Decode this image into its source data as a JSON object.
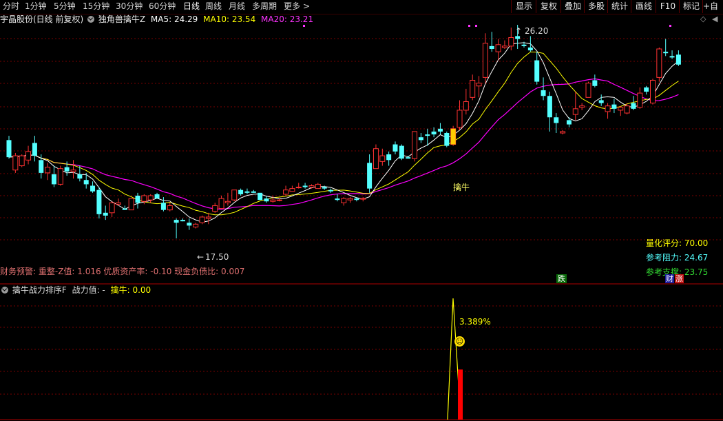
{
  "toolbar": {
    "periods": [
      "分时",
      "1分钟",
      "5分钟",
      "15分钟",
      "30分钟",
      "60分钟",
      "日线",
      "周线",
      "月线",
      "多周期",
      "更多"
    ],
    "active_index": 6,
    "more_arrow": ">",
    "right_buttons": [
      "显示",
      "复权",
      "叠加",
      "多股",
      "统计",
      "画线",
      "F10",
      "标记",
      "+自选"
    ],
    "small_icons": [
      "◇",
      "◀"
    ]
  },
  "info": {
    "stock": "宇晶股份(日线 前复权)",
    "indicator": "独角兽擒牛Z",
    "ma5_label": "MA5: 24.29",
    "ma10_label": "MA10: 23.54",
    "ma20_label": "MA20: 23.21"
  },
  "annotations": {
    "high_label": "26.20",
    "low_label": "17.50",
    "buy_label": "擒牛",
    "fall_badge": "跌",
    "rise_badge": "涨",
    "finance_badge": "财"
  },
  "metrics": {
    "score_label": "量化评分:",
    "score_value": "70.00",
    "resist_label": "参考阻力:",
    "resist_value": "24.67",
    "support_label": "参考支撑:",
    "support_value": "23.75"
  },
  "footer_text": "财务预警: 重整-Z值: 1.016 优质资产率: -0.10 现金负债比: 0.007",
  "sub": {
    "title": "擒牛战力排序F",
    "power_label": "战力值: -",
    "bull_label": "擒牛: 0.00",
    "peak_label": "3.389%"
  },
  "colors": {
    "up": "#ff3232",
    "down": "#54ffff",
    "ma5": "#ffffff",
    "ma10": "#ffff00",
    "ma20": "#ff00ff",
    "grid": "#7a0000"
  },
  "candles": [
    [
      24.4,
      24.7,
      23.1,
      23.2
    ],
    [
      22.3,
      23.5,
      22.1,
      23.3
    ],
    [
      22.6,
      23.4,
      22.5,
      23.3
    ],
    [
      23.0,
      24.0,
      22.7,
      23.6
    ],
    [
      24.2,
      24.7,
      22.9,
      23.3
    ],
    [
      23.0,
      23.4,
      21.7,
      22.1
    ],
    [
      22.1,
      22.8,
      21.6,
      22.5
    ],
    [
      22.0,
      22.6,
      21.1,
      21.3
    ],
    [
      21.3,
      22.6,
      21.2,
      22.4
    ],
    [
      22.5,
      22.9,
      21.9,
      22.2
    ],
    [
      22.2,
      23.0,
      21.7,
      22.3
    ],
    [
      22.0,
      22.6,
      21.5,
      21.7
    ],
    [
      21.6,
      22.1,
      21.0,
      21.3
    ],
    [
      21.2,
      21.5,
      20.7,
      20.8
    ],
    [
      20.9,
      21.1,
      18.9,
      19.2
    ],
    [
      19.3,
      19.8,
      18.8,
      19.1
    ],
    [
      19.3,
      20.1,
      19.0,
      20.0
    ],
    [
      19.9,
      20.3,
      19.8,
      20.0
    ],
    [
      19.6,
      19.8,
      19.5,
      19.5
    ],
    [
      19.5,
      20.3,
      19.5,
      20.3
    ],
    [
      20.5,
      20.7,
      19.6,
      20.0
    ],
    [
      20.1,
      20.6,
      19.9,
      20.5
    ],
    [
      20.2,
      20.6,
      20.0,
      20.5
    ],
    [
      20.6,
      20.7,
      20.3,
      20.3
    ],
    [
      20.0,
      20.4,
      19.4,
      19.5
    ],
    [
      19.5,
      20.0,
      19.4,
      19.8
    ],
    [
      18.8,
      18.9,
      17.5,
      18.6
    ],
    [
      18.8,
      18.9,
      18.7,
      18.7
    ],
    [
      18.6,
      18.9,
      18.1,
      18.4
    ],
    [
      18.3,
      18.6,
      18.2,
      18.5
    ],
    [
      18.6,
      19.1,
      18.5,
      19.0
    ],
    [
      18.9,
      19.3,
      18.5,
      19.0
    ],
    [
      19.4,
      20.0,
      19.3,
      19.8
    ],
    [
      19.6,
      20.5,
      19.6,
      20.3
    ],
    [
      20.0,
      20.7,
      19.8,
      20.1
    ],
    [
      20.2,
      20.9,
      20.1,
      20.9
    ],
    [
      20.9,
      21.0,
      20.5,
      20.6
    ],
    [
      20.8,
      21.0,
      20.6,
      20.7
    ],
    [
      20.8,
      20.9,
      20.7,
      20.7
    ],
    [
      20.7,
      20.7,
      20.2,
      20.2
    ],
    [
      20.3,
      20.5,
      20.0,
      20.1
    ],
    [
      20.1,
      20.5,
      20.0,
      20.2
    ],
    [
      20.2,
      20.3,
      20.1,
      20.2
    ],
    [
      20.6,
      21.2,
      20.5,
      20.9
    ],
    [
      20.8,
      21.2,
      20.8,
      21.0
    ],
    [
      21.1,
      21.4,
      21.0,
      21.1
    ],
    [
      21.2,
      21.4,
      21.0,
      21.1
    ],
    [
      21.1,
      21.3,
      21.0,
      21.2
    ],
    [
      21.0,
      21.4,
      21.0,
      21.3
    ],
    [
      21.1,
      21.2,
      20.9,
      21.0
    ],
    [
      20.9,
      21.0,
      20.7,
      20.8
    ],
    [
      20.3,
      20.6,
      20.1,
      20.2
    ],
    [
      20.0,
      20.4,
      19.8,
      20.3
    ],
    [
      20.2,
      20.4,
      20.0,
      20.3
    ],
    [
      20.3,
      20.4,
      20.1,
      20.2
    ],
    [
      20.3,
      20.4,
      20.1,
      20.3
    ],
    [
      22.8,
      23.4,
      20.7,
      21.0
    ],
    [
      22.4,
      24.1,
      22.4,
      23.8
    ],
    [
      22.9,
      23.8,
      22.6,
      23.3
    ],
    [
      23.4,
      23.6,
      22.6,
      23.0
    ],
    [
      24.1,
      24.3,
      23.4,
      23.6
    ],
    [
      24.0,
      24.1,
      23.0,
      23.1
    ],
    [
      23.2,
      23.3,
      23.1,
      23.1
    ],
    [
      23.1,
      25.0,
      22.9,
      25.0
    ],
    [
      24.6,
      24.9,
      24.2,
      24.4
    ],
    [
      24.8,
      25.2,
      24.0,
      24.7
    ],
    [
      25.0,
      25.3,
      24.6,
      24.8
    ],
    [
      25.2,
      25.6,
      24.8,
      25.0
    ],
    [
      24.9,
      25.0,
      23.9,
      24.0
    ],
    [
      24.1,
      25.4,
      24.0,
      25.2
    ],
    [
      25.3,
      27.2,
      25.1,
      26.5
    ],
    [
      26.5,
      28.0,
      26.2,
      27.1
    ],
    [
      27.4,
      29.0,
      27.2,
      28.6
    ],
    [
      28.2,
      28.9,
      27.4,
      28.4
    ],
    [
      28.8,
      31.9,
      28.4,
      31.2
    ],
    [
      31.0,
      32.0,
      30.6,
      30.8
    ],
    [
      30.6,
      31.5,
      30.0,
      31.1
    ],
    [
      30.9,
      31.4,
      30.8,
      31.0
    ],
    [
      31.0,
      32.3,
      30.7,
      31.6
    ],
    [
      31.7,
      32.5,
      30.8,
      31.5
    ],
    [
      31.1,
      31.3,
      30.9,
      31.0
    ],
    [
      30.9,
      31.7,
      30.6,
      30.7
    ],
    [
      30.0,
      30.6,
      28.3,
      28.5
    ],
    [
      27.9,
      28.8,
      27.2,
      27.5
    ],
    [
      27.5,
      27.8,
      25.0,
      26.0
    ],
    [
      26.0,
      26.3,
      24.9,
      25.6
    ],
    [
      24.9,
      25.1,
      24.8,
      25.0
    ],
    [
      25.8,
      26.0,
      25.3,
      25.5
    ],
    [
      26.2,
      27.8,
      25.8,
      26.6
    ],
    [
      26.7,
      27.0,
      26.5,
      26.8
    ],
    [
      27.4,
      28.5,
      27.4,
      28.4
    ],
    [
      28.6,
      29.0,
      28.1,
      28.2
    ],
    [
      27.2,
      27.6,
      26.8,
      27.0
    ],
    [
      26.4,
      27.0,
      25.9,
      26.8
    ],
    [
      26.9,
      27.3,
      26.3,
      26.6
    ],
    [
      26.5,
      26.8,
      26.1,
      26.7
    ],
    [
      26.3,
      27.0,
      26.2,
      26.8
    ],
    [
      27.0,
      27.5,
      26.5,
      26.6
    ],
    [
      26.7,
      28.1,
      26.6,
      27.7
    ],
    [
      28.1,
      28.2,
      27.6,
      27.8
    ],
    [
      27.0,
      28.7,
      26.9,
      28.6
    ],
    [
      28.8,
      30.9,
      28.5,
      30.8
    ],
    [
      30.6,
      31.5,
      30.3,
      30.5
    ],
    [
      30.3,
      30.7,
      30.1,
      30.2
    ],
    [
      30.4,
      30.7,
      29.6,
      29.7
    ]
  ],
  "sub_line": [
    [
      650,
      0.0
    ],
    [
      658,
      3.389
    ],
    [
      668,
      0.35
    ]
  ],
  "sub_bar": [
    665,
    1.4
  ]
}
